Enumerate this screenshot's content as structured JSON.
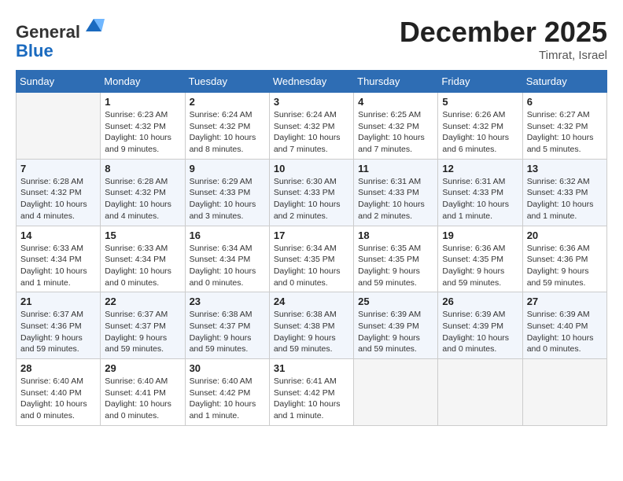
{
  "header": {
    "logo_line1": "General",
    "logo_line2": "Blue",
    "month_title": "December 2025",
    "location": "Timrat, Israel"
  },
  "weekdays": [
    "Sunday",
    "Monday",
    "Tuesday",
    "Wednesday",
    "Thursday",
    "Friday",
    "Saturday"
  ],
  "weeks": [
    [
      {
        "day": "",
        "info": ""
      },
      {
        "day": "1",
        "info": "Sunrise: 6:23 AM\nSunset: 4:32 PM\nDaylight: 10 hours and 9 minutes."
      },
      {
        "day": "2",
        "info": "Sunrise: 6:24 AM\nSunset: 4:32 PM\nDaylight: 10 hours and 8 minutes."
      },
      {
        "day": "3",
        "info": "Sunrise: 6:24 AM\nSunset: 4:32 PM\nDaylight: 10 hours and 7 minutes."
      },
      {
        "day": "4",
        "info": "Sunrise: 6:25 AM\nSunset: 4:32 PM\nDaylight: 10 hours and 7 minutes."
      },
      {
        "day": "5",
        "info": "Sunrise: 6:26 AM\nSunset: 4:32 PM\nDaylight: 10 hours and 6 minutes."
      },
      {
        "day": "6",
        "info": "Sunrise: 6:27 AM\nSunset: 4:32 PM\nDaylight: 10 hours and 5 minutes."
      }
    ],
    [
      {
        "day": "7",
        "info": "Sunrise: 6:28 AM\nSunset: 4:32 PM\nDaylight: 10 hours and 4 minutes."
      },
      {
        "day": "8",
        "info": "Sunrise: 6:28 AM\nSunset: 4:32 PM\nDaylight: 10 hours and 4 minutes."
      },
      {
        "day": "9",
        "info": "Sunrise: 6:29 AM\nSunset: 4:33 PM\nDaylight: 10 hours and 3 minutes."
      },
      {
        "day": "10",
        "info": "Sunrise: 6:30 AM\nSunset: 4:33 PM\nDaylight: 10 hours and 2 minutes."
      },
      {
        "day": "11",
        "info": "Sunrise: 6:31 AM\nSunset: 4:33 PM\nDaylight: 10 hours and 2 minutes."
      },
      {
        "day": "12",
        "info": "Sunrise: 6:31 AM\nSunset: 4:33 PM\nDaylight: 10 hours and 1 minute."
      },
      {
        "day": "13",
        "info": "Sunrise: 6:32 AM\nSunset: 4:33 PM\nDaylight: 10 hours and 1 minute."
      }
    ],
    [
      {
        "day": "14",
        "info": "Sunrise: 6:33 AM\nSunset: 4:34 PM\nDaylight: 10 hours and 1 minute."
      },
      {
        "day": "15",
        "info": "Sunrise: 6:33 AM\nSunset: 4:34 PM\nDaylight: 10 hours and 0 minutes."
      },
      {
        "day": "16",
        "info": "Sunrise: 6:34 AM\nSunset: 4:34 PM\nDaylight: 10 hours and 0 minutes."
      },
      {
        "day": "17",
        "info": "Sunrise: 6:34 AM\nSunset: 4:35 PM\nDaylight: 10 hours and 0 minutes."
      },
      {
        "day": "18",
        "info": "Sunrise: 6:35 AM\nSunset: 4:35 PM\nDaylight: 9 hours and 59 minutes."
      },
      {
        "day": "19",
        "info": "Sunrise: 6:36 AM\nSunset: 4:35 PM\nDaylight: 9 hours and 59 minutes."
      },
      {
        "day": "20",
        "info": "Sunrise: 6:36 AM\nSunset: 4:36 PM\nDaylight: 9 hours and 59 minutes."
      }
    ],
    [
      {
        "day": "21",
        "info": "Sunrise: 6:37 AM\nSunset: 4:36 PM\nDaylight: 9 hours and 59 minutes."
      },
      {
        "day": "22",
        "info": "Sunrise: 6:37 AM\nSunset: 4:37 PM\nDaylight: 9 hours and 59 minutes."
      },
      {
        "day": "23",
        "info": "Sunrise: 6:38 AM\nSunset: 4:37 PM\nDaylight: 9 hours and 59 minutes."
      },
      {
        "day": "24",
        "info": "Sunrise: 6:38 AM\nSunset: 4:38 PM\nDaylight: 9 hours and 59 minutes."
      },
      {
        "day": "25",
        "info": "Sunrise: 6:39 AM\nSunset: 4:39 PM\nDaylight: 9 hours and 59 minutes."
      },
      {
        "day": "26",
        "info": "Sunrise: 6:39 AM\nSunset: 4:39 PM\nDaylight: 10 hours and 0 minutes."
      },
      {
        "day": "27",
        "info": "Sunrise: 6:39 AM\nSunset: 4:40 PM\nDaylight: 10 hours and 0 minutes."
      }
    ],
    [
      {
        "day": "28",
        "info": "Sunrise: 6:40 AM\nSunset: 4:40 PM\nDaylight: 10 hours and 0 minutes."
      },
      {
        "day": "29",
        "info": "Sunrise: 6:40 AM\nSunset: 4:41 PM\nDaylight: 10 hours and 0 minutes."
      },
      {
        "day": "30",
        "info": "Sunrise: 6:40 AM\nSunset: 4:42 PM\nDaylight: 10 hours and 1 minute."
      },
      {
        "day": "31",
        "info": "Sunrise: 6:41 AM\nSunset: 4:42 PM\nDaylight: 10 hours and 1 minute."
      },
      {
        "day": "",
        "info": ""
      },
      {
        "day": "",
        "info": ""
      },
      {
        "day": "",
        "info": ""
      }
    ]
  ]
}
